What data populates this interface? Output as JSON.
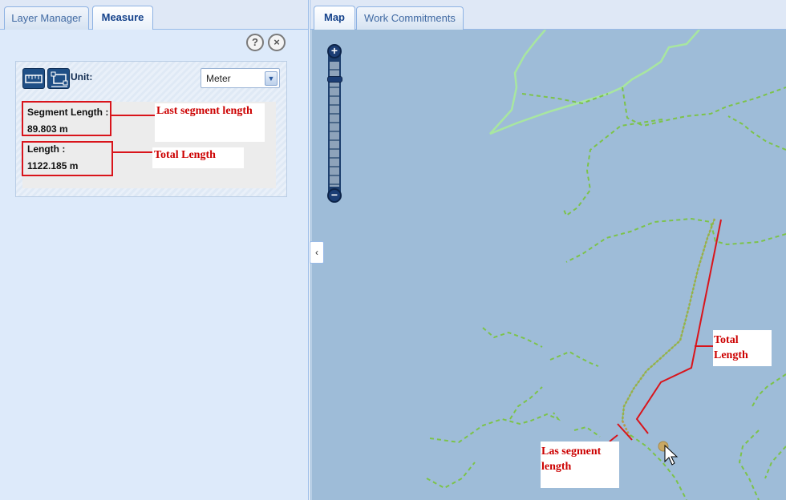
{
  "left_tabs": [
    {
      "label": "Layer Manager",
      "active": false
    },
    {
      "label": "Measure",
      "active": true
    }
  ],
  "right_tabs": [
    {
      "label": "Map",
      "active": true
    },
    {
      "label": "Work Commitments",
      "active": false
    }
  ],
  "panel_controls": {
    "help_glyph": "?",
    "close_glyph": "×"
  },
  "measure": {
    "unit_label": "Unit:",
    "unit_value": "Meter",
    "segment_label": "Segment Length :",
    "segment_value": "89.803 m",
    "length_label": "Length :",
    "length_value": "1122.185 m"
  },
  "annotations": {
    "last_segment": "Last segment length",
    "total_length": "Total Length",
    "map_total": "Total Length",
    "map_last_segment": "Las segment length"
  },
  "map_controls": {
    "zoom_in": "+",
    "zoom_out": "−",
    "collapse": "‹"
  },
  "colors": {
    "map_water": "#9ebcd8",
    "dotted_path": "#7cc34a",
    "solid_path": "#a8e6a0",
    "measure_line": "#b89a4a",
    "annotation_red": "#d9141b"
  },
  "icons": [
    "help-icon",
    "close-icon",
    "measure-distance-icon",
    "measure-area-icon",
    "chevron-down-icon",
    "chevron-left-icon",
    "zoom-in-icon",
    "zoom-out-icon",
    "mouse-cursor-icon"
  ]
}
